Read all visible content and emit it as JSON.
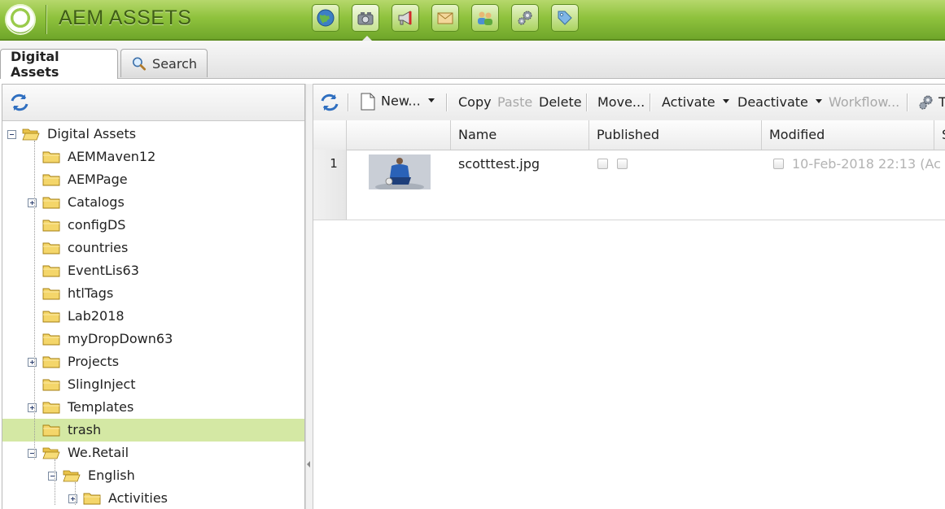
{
  "header": {
    "app_title": "AEM ASSETS",
    "nav_icons": [
      "globe-icon",
      "camera-icon",
      "megaphone-icon",
      "envelope-icon",
      "users-icon",
      "gears-icon",
      "tag-icon"
    ],
    "accent": "#8fc23d"
  },
  "tabs": [
    {
      "label": "Digital Assets",
      "active": true
    },
    {
      "label": "Search",
      "icon": "search-icon",
      "active": false
    }
  ],
  "tree": {
    "root": "Digital Assets",
    "items": [
      "AEMMaven12",
      "AEMPage",
      "Catalogs",
      "configDS",
      "countries",
      "EventLis63",
      "htlTags",
      "Lab2018",
      "myDropDown63",
      "Projects",
      "SlingInject",
      "Templates",
      "trash",
      "We.Retail",
      "English",
      "Activities"
    ],
    "selected": "trash",
    "selected_color": "#d4e8a4"
  },
  "toolbar": {
    "new": "New...",
    "copy": "Copy",
    "paste": "Paste",
    "delete": "Delete",
    "move": "Move...",
    "activate": "Activate",
    "deactivate": "Deactivate",
    "workflow": "Workflow...",
    "tools_partial": "T"
  },
  "grid": {
    "columns": [
      "Name",
      "Published",
      "Modified",
      "S"
    ],
    "rows": [
      {
        "num": "1",
        "name": "scotttest.jpg",
        "modified": "10-Feb-2018 22:13 (Ac"
      }
    ]
  }
}
